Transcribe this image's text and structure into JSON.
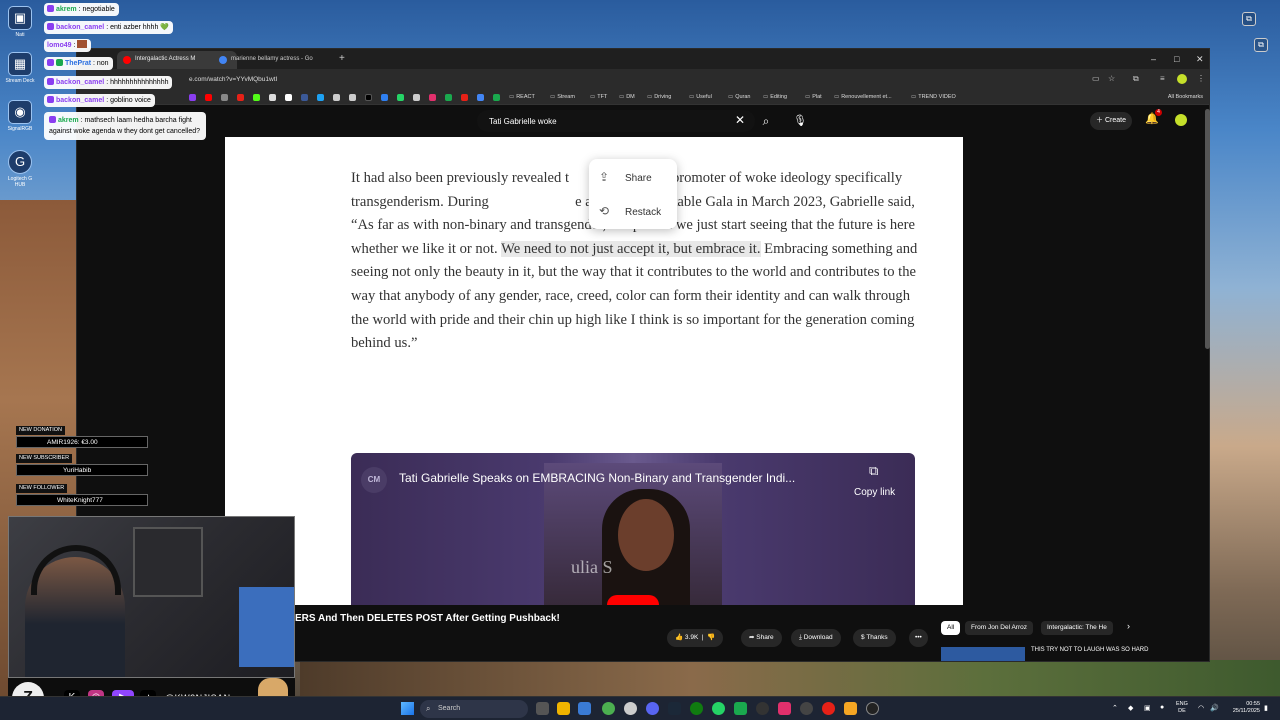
{
  "desktop": {
    "icons": [
      {
        "label": "Nati",
        "glyph": "▣"
      },
      {
        "label": "Stream Deck",
        "glyph": "▦"
      },
      {
        "label": "SignalRGB",
        "glyph": "◉"
      },
      {
        "label": "Logitech G HUB",
        "glyph": "G"
      }
    ]
  },
  "browser": {
    "tabs": [
      {
        "label": "Intergalactic Actress M"
      },
      {
        "label": "marienne bellamy actress - Go"
      }
    ],
    "url": "e.com/watch?v=YYvMQbu1wtI",
    "bookmarks": [
      "REACT",
      "Stream",
      "TFT",
      "DM",
      "Driving",
      "Useful",
      "Quran",
      "Editing",
      "Plat",
      "Renouvellement et...",
      "TREND VIDEO"
    ],
    "all_bookmarks": "All Bookmarks"
  },
  "youtube": {
    "search_query": "Tati Gabrielle woke",
    "create_label": "Create",
    "notification_count": "4"
  },
  "article": {
    "part1": "It had also been previously revealed t",
    "part2": " is a promoter of woke ideology specifically transgenderism. During ",
    "part3": "e at the Unforgettable Gala in March 2023, Gabrielle said, “As far as with no",
    "part4": "n-binary and transgender, I hope that we just start seeing that the future is here whether we like it or not. ",
    "highlight": "We need to not just accept it, but embrace it.",
    "part5": " Embracing something and seeing not only the beauty in it, but the way that it contributes to the world and contributes to the way that anybody of any gender, race, creed, color can form their identity and can walk through the world with pride and their chin up high like I think is so important for the generation coming behind us.”"
  },
  "context_menu": {
    "share": "Share",
    "restack": "Restack"
  },
  "embed": {
    "channel_badge": "CM",
    "title": "Tati Gabrielle Speaks on EMBRACING Non-Binary and Transgender Indi...",
    "copy_link": "Copy link",
    "brand_text": "ulia S"
  },
  "video": {
    "title": "ERS And Then DELETES POST After Getting Pushback!",
    "likes": "3.9K",
    "share": "Share",
    "download": "Download",
    "thanks": "Thanks",
    "more": "•••",
    "chips": [
      "All",
      "From Jon Del Arroz",
      "Intergalactic: The He"
    ],
    "rec_title": "THIS TRY NOT TO LAUGH WAS SO HARD"
  },
  "chat": [
    {
      "user": "akrem",
      "text": " : negotiable",
      "color": "green"
    },
    {
      "user": "backon_camel",
      "text": " : enti azber hhhh 💚",
      "color": "purple"
    },
    {
      "user": "lomo49",
      "text": " : ",
      "color": "purple"
    },
    {
      "user": "ThePrat",
      "text": " : non",
      "color": "blue"
    },
    {
      "user": "backon_camel",
      "text": " : hhhhhhhhhhhhhhh",
      "color": "purple"
    },
    {
      "user": "backon_camel",
      "text": " : goblino voice",
      "color": "purple"
    },
    {
      "user": "akrem",
      "text": " : mathsech laam hedha barcha fight against woke agenda w they dont get cancelled?",
      "color": "green"
    }
  ],
  "alerts": [
    {
      "tag": "NEW DONATION",
      "value": "AMIR1926: €3.00"
    },
    {
      "tag": "NEW SUBSCRIBER",
      "value": "YuriHabib"
    },
    {
      "tag": "NEW FOLLOWER",
      "value": "WhiteKnight777"
    }
  ],
  "webcam": {
    "handle": "@KW3NJISAN",
    "logo": "Z"
  },
  "taskbar": {
    "search_placeholder": "Search",
    "lang_line1": "ENG",
    "lang_line2": "DE",
    "time": "00:55",
    "date": "25/11/2025"
  },
  "colors": {
    "youtube_red": "#ff0000",
    "chat_green": "#1aa94e",
    "chat_purple": "#8a3ef0"
  }
}
